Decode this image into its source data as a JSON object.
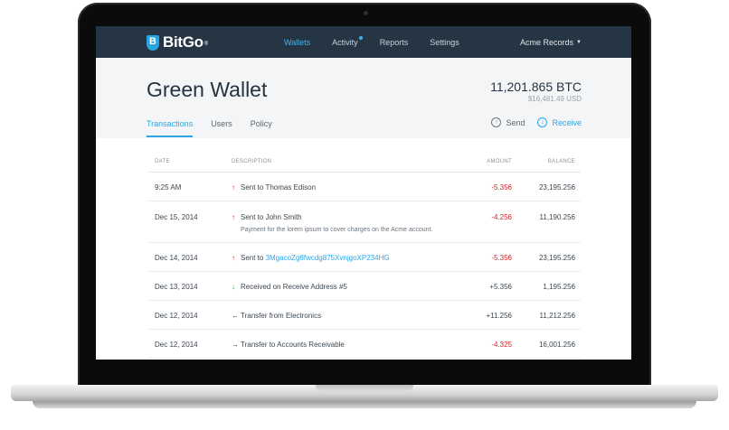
{
  "nav": {
    "brand": "BitGo",
    "reg_mark": "®",
    "links": [
      "Wallets",
      "Activity",
      "Reports",
      "Settings"
    ],
    "account": "Acme Records"
  },
  "header": {
    "title": "Green Wallet",
    "balance_btc": "11,201.865 BTC",
    "balance_usd": "$16,481.49 USD",
    "tabs": [
      "Transactions",
      "Users",
      "Policy"
    ],
    "send": "Send",
    "receive": "Receive"
  },
  "table": {
    "columns": [
      "DATE",
      "DESCRIPTION",
      "AMOUNT",
      "BALANCE"
    ],
    "rows": [
      {
        "date": "9:25 AM",
        "direction": "up",
        "prefix": "Sent to",
        "target": "Thomas Edison",
        "amount": "-5.356",
        "balance": "23,195.256"
      },
      {
        "date": "Dec 15, 2014",
        "direction": "up",
        "prefix": "Sent to",
        "target": "John Smith",
        "memo": "Payment for the lorem ipsum to cover charges on the Acme account.",
        "amount": "-4.256",
        "balance": "11,190.256"
      },
      {
        "date": "Dec 14, 2014",
        "direction": "up",
        "prefix": "Sent to",
        "target": "3MgacoZg6fwcdg875XvnjgoXP234HG",
        "amount": "-5.356",
        "balance": "23,195.256"
      },
      {
        "date": "Dec 13, 2014",
        "direction": "down",
        "prefix": "Received on",
        "target": "Receive Address #5",
        "amount": "+5.356",
        "balance": "1,195.256"
      },
      {
        "date": "Dec 12, 2014",
        "direction": "left",
        "prefix": "Transfer from",
        "target": "Electronics",
        "amount": "+11.256",
        "balance": "11,212.256"
      },
      {
        "date": "Dec 12, 2014",
        "direction": "right",
        "prefix": "Transfer to",
        "target": "Accounts Receivable",
        "amount": "-4.325",
        "balance": "16,001.256"
      }
    ]
  }
}
